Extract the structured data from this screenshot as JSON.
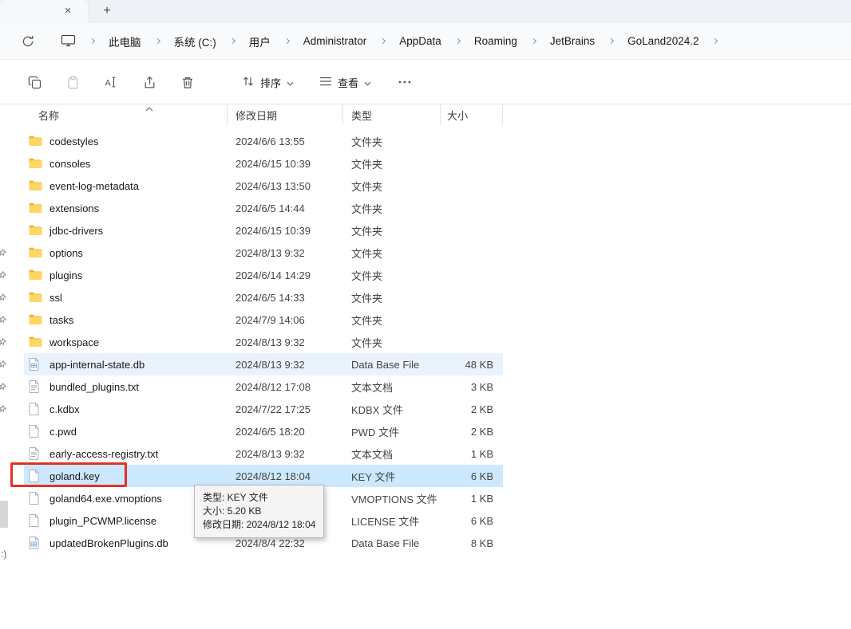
{
  "tabbar": {
    "close_label": "✕",
    "new_tab_label": "+"
  },
  "breadcrumb": {
    "items": [
      "此电脑",
      "系统 (C:)",
      "用户",
      "Administrator",
      "AppData",
      "Roaming",
      "JetBrains",
      "GoLand2024.2"
    ]
  },
  "toolbar": {
    "sort_label": "排序",
    "view_label": "查看"
  },
  "list": {
    "columns": {
      "name": "名称",
      "date": "修改日期",
      "type": "类型",
      "size": "大小"
    },
    "rows": [
      {
        "icon": "folder",
        "name": "codestyles",
        "date": "2024/6/6 13:55",
        "type": "文件夹",
        "size": ""
      },
      {
        "icon": "folder",
        "name": "consoles",
        "date": "2024/6/15 10:39",
        "type": "文件夹",
        "size": ""
      },
      {
        "icon": "folder",
        "name": "event-log-metadata",
        "date": "2024/6/13 13:50",
        "type": "文件夹",
        "size": ""
      },
      {
        "icon": "folder",
        "name": "extensions",
        "date": "2024/6/5 14:44",
        "type": "文件夹",
        "size": ""
      },
      {
        "icon": "folder",
        "name": "jdbc-drivers",
        "date": "2024/6/15 10:39",
        "type": "文件夹",
        "size": ""
      },
      {
        "icon": "folder",
        "name": "options",
        "date": "2024/8/13 9:32",
        "type": "文件夹",
        "size": ""
      },
      {
        "icon": "folder",
        "name": "plugins",
        "date": "2024/6/14 14:29",
        "type": "文件夹",
        "size": ""
      },
      {
        "icon": "folder",
        "name": "ssl",
        "date": "2024/6/5 14:33",
        "type": "文件夹",
        "size": ""
      },
      {
        "icon": "folder",
        "name": "tasks",
        "date": "2024/7/9 14:06",
        "type": "文件夹",
        "size": ""
      },
      {
        "icon": "folder",
        "name": "workspace",
        "date": "2024/8/13 9:32",
        "type": "文件夹",
        "size": ""
      },
      {
        "icon": "db",
        "name": "app-internal-state.db",
        "date": "2024/8/13 9:32",
        "type": "Data Base File",
        "size": "48 KB",
        "state": "hover"
      },
      {
        "icon": "txt",
        "name": "bundled_plugins.txt",
        "date": "2024/8/12 17:08",
        "type": "文本文档",
        "size": "3 KB"
      },
      {
        "icon": "file",
        "name": "c.kdbx",
        "date": "2024/7/22 17:25",
        "type": "KDBX 文件",
        "size": "2 KB"
      },
      {
        "icon": "file",
        "name": "c.pwd",
        "date": "2024/6/5 18:20",
        "type": "PWD 文件",
        "size": "2 KB"
      },
      {
        "icon": "txt",
        "name": "early-access-registry.txt",
        "date": "2024/8/13 9:32",
        "type": "文本文档",
        "size": "1 KB"
      },
      {
        "icon": "file",
        "name": "goland.key",
        "date": "2024/8/12 18:04",
        "type": "KEY 文件",
        "size": "6 KB",
        "state": "selected",
        "annotated": true
      },
      {
        "icon": "file",
        "name": "goland64.exe.vmoptions",
        "date": "",
        "type": "VMOPTIONS 文件",
        "size": "1 KB"
      },
      {
        "icon": "file",
        "name": "plugin_PCWMP.license",
        "date": "",
        "type": "LICENSE 文件",
        "size": "6 KB"
      },
      {
        "icon": "db",
        "name": "updatedBrokenPlugins.db",
        "date": "2024/8/4 22:32",
        "type": "Data Base File",
        "size": "8 KB"
      }
    ]
  },
  "tooltip": {
    "lines": [
      "类型: KEY 文件",
      "大小: 5.20 KB",
      "修改日期: 2024/8/12 18:04"
    ]
  },
  "statusbar": {
    "text": ":)"
  },
  "colors": {
    "selection": "#cce8ff",
    "hover": "#e9f3fe",
    "annotation": "#e03226"
  }
}
